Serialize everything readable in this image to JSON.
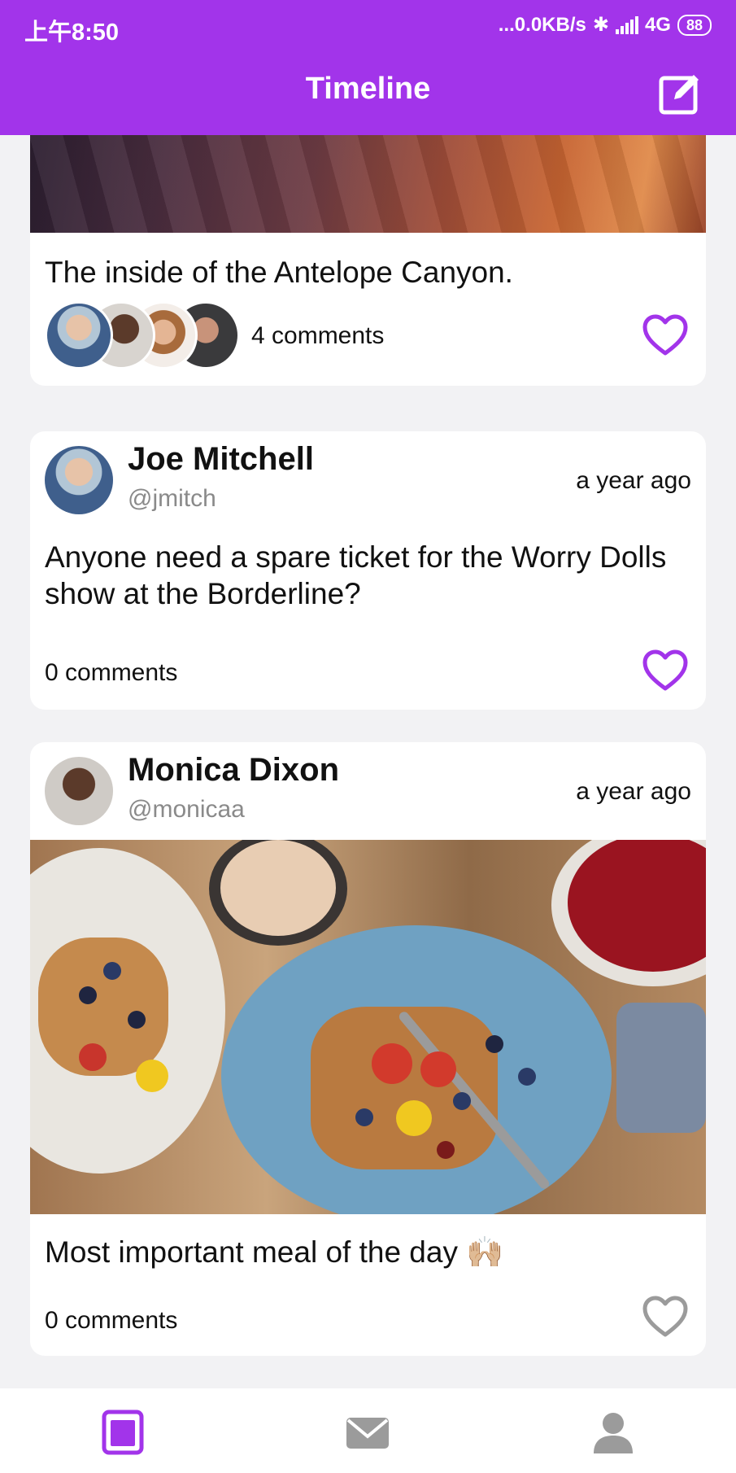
{
  "status_bar": {
    "time": "上午8:50",
    "network_speed": "...0.0KB/s",
    "network_type": "4G",
    "battery": "88"
  },
  "app_bar": {
    "title": "Timeline",
    "compose_icon": "compose-icon"
  },
  "posts": [
    {
      "image": "antelope-canyon-photo",
      "text": "The inside of the Antelope Canyon.",
      "comments": "4 comments",
      "liked": true
    },
    {
      "author": "Joe Mitchell",
      "handle": "@jmitch",
      "time": "a year ago",
      "text": "Anyone need a spare ticket for the Worry Dolls show at the Borderline?",
      "comments": "0 comments",
      "liked": true
    },
    {
      "author": "Monica Dixon",
      "handle": "@monicaa",
      "time": "a year ago",
      "image": "breakfast-food-photo",
      "text": "Most important meal of the day 🙌🏼",
      "comments": "0 comments",
      "liked": false
    }
  ],
  "tab_bar": {
    "items": [
      "timeline-icon",
      "messages-icon",
      "profile-icon"
    ],
    "active": "timeline-icon"
  },
  "colors": {
    "accent": "#a234ea",
    "inactive": "#9b9b9b",
    "background": "#f2f2f4"
  }
}
